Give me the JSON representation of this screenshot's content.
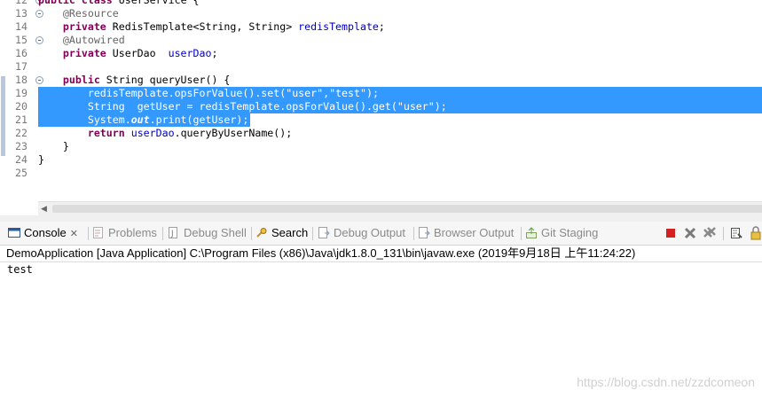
{
  "editor": {
    "lines": [
      {
        "n": "12",
        "fold": true,
        "segs": [
          [
            "kw",
            "public "
          ],
          [
            "kw",
            "class "
          ],
          [
            "",
            "UserService {"
          ]
        ]
      },
      {
        "n": "13",
        "fold": true,
        "segs": [
          [
            "",
            "    "
          ],
          [
            "ann",
            "@Resource"
          ]
        ]
      },
      {
        "n": "14",
        "fold": false,
        "segs": [
          [
            "",
            "    "
          ],
          [
            "kw",
            "private "
          ],
          [
            "",
            "RedisTemplate<String, String> "
          ],
          [
            "fld",
            "redisTemplate"
          ],
          [
            "",
            ";"
          ]
        ]
      },
      {
        "n": "15",
        "fold": true,
        "segs": [
          [
            "",
            "    "
          ],
          [
            "ann",
            "@Autowired"
          ]
        ]
      },
      {
        "n": "16",
        "fold": false,
        "segs": [
          [
            "",
            "    "
          ],
          [
            "kw",
            "private "
          ],
          [
            "",
            "UserDao  "
          ],
          [
            "fld",
            "userDao"
          ],
          [
            "",
            ";"
          ]
        ]
      },
      {
        "n": "17",
        "fold": false,
        "segs": [
          [
            "",
            ""
          ]
        ]
      },
      {
        "n": "18",
        "fold": true,
        "segs": [
          [
            "",
            "    "
          ],
          [
            "kw",
            "public "
          ],
          [
            "",
            "String queryUser() {"
          ]
        ]
      },
      {
        "n": "19",
        "fold": false,
        "selected": true,
        "segs": [
          [
            "",
            "        "
          ],
          [
            "fld",
            "redisTemplate"
          ],
          [
            "",
            ".opsForValue().set("
          ],
          [
            "str",
            "\"user\""
          ],
          [
            "",
            ","
          ],
          [
            "str",
            "\"test\""
          ],
          [
            "",
            ");"
          ]
        ]
      },
      {
        "n": "20",
        "fold": false,
        "selected": true,
        "segs": [
          [
            "",
            "        String  getUser = "
          ],
          [
            "fld",
            "redisTemplate"
          ],
          [
            "",
            ".opsForValue().get("
          ],
          [
            "str",
            "\"user\""
          ],
          [
            "",
            ");"
          ]
        ]
      },
      {
        "n": "21",
        "fold": false,
        "selected": true,
        "partial": true,
        "segs": [
          [
            "",
            "        System."
          ],
          [
            "it",
            "out"
          ],
          [
            "",
            ".print(getUser);"
          ]
        ]
      },
      {
        "n": "22",
        "fold": false,
        "segs": [
          [
            "",
            "        "
          ],
          [
            "kw",
            "return "
          ],
          [
            "fld",
            "userDao"
          ],
          [
            "",
            ".queryByUserName();"
          ]
        ]
      },
      {
        "n": "23",
        "fold": false,
        "segs": [
          [
            "",
            "    }"
          ]
        ]
      },
      {
        "n": "24",
        "fold": false,
        "segs": [
          [
            "",
            "}"
          ]
        ]
      },
      {
        "n": "25",
        "fold": false,
        "segs": [
          [
            "",
            ""
          ]
        ]
      }
    ]
  },
  "tabs": [
    {
      "label": "Console",
      "icon": "console-icon",
      "active": true,
      "close": "✕"
    },
    {
      "label": "Problems",
      "icon": "problems-icon",
      "active": false
    },
    {
      "label": "Debug Shell",
      "icon": "debug-shell-icon",
      "active": false
    },
    {
      "label": "Search",
      "icon": "search-icon",
      "active": true
    },
    {
      "label": "Debug Output",
      "icon": "debug-output-icon",
      "active": false
    },
    {
      "label": "Browser Output",
      "icon": "browser-output-icon",
      "active": false
    },
    {
      "label": "Git Staging",
      "icon": "git-staging-icon",
      "active": false
    }
  ],
  "console": {
    "title": "DemoApplication [Java Application] C:\\Program Files (x86)\\Java\\jdk1.8.0_131\\bin\\javaw.exe (2019年9月18日 上午11:24:22)",
    "output": "test"
  },
  "watermark": "https://blog.csdn.net/zzdcomeon",
  "colors": {
    "selection": "#3399ff",
    "keyword": "#7f0055",
    "field": "#0000c0",
    "string": "#2a00ff",
    "annotation": "#646464",
    "terminate": "#d42020"
  }
}
